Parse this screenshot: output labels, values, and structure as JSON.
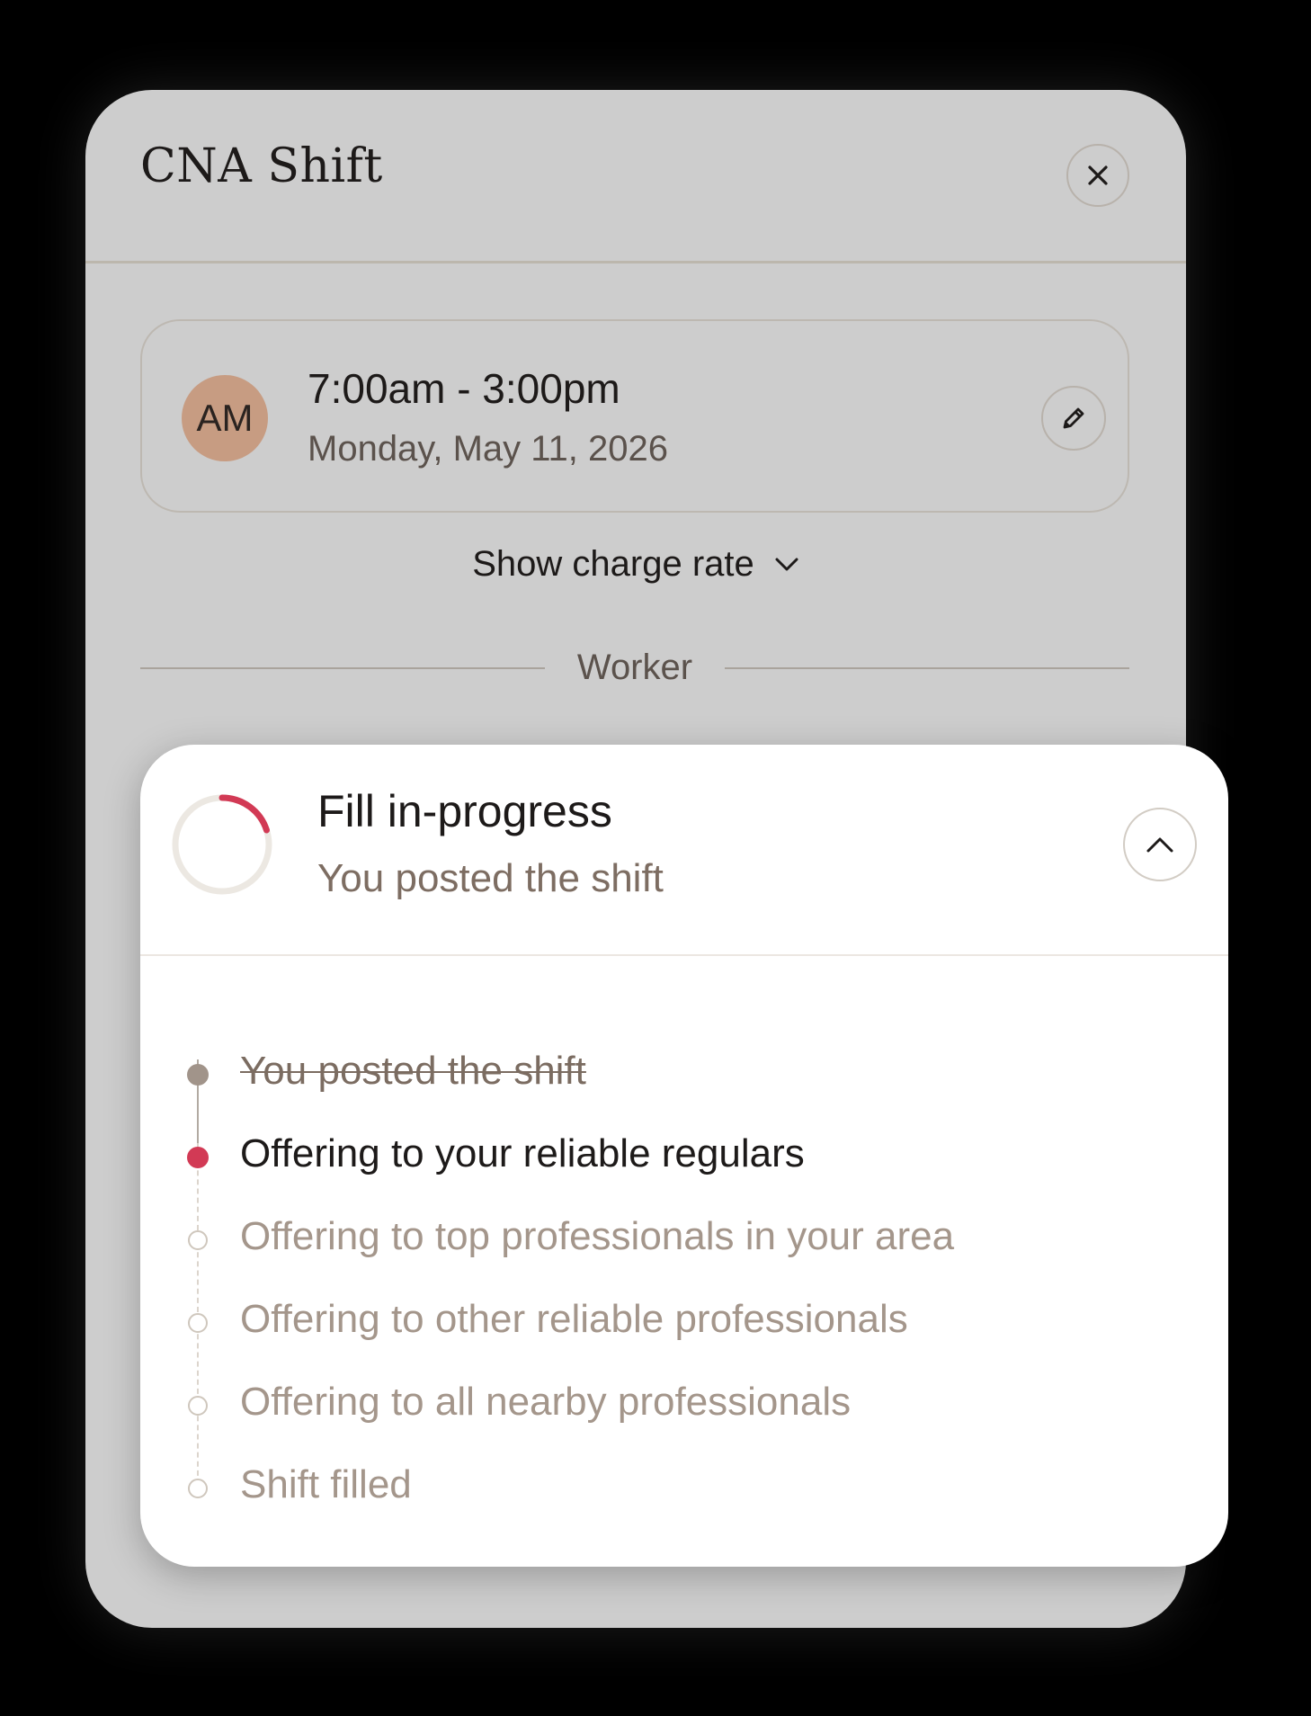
{
  "modal": {
    "title": "CNA Shift"
  },
  "shift": {
    "avatar_initials": "AM",
    "time_range": "7:00am - 3:00pm",
    "date": "Monday, May 11, 2026"
  },
  "charge_rate": {
    "toggle_label": "Show charge rate"
  },
  "worker_section": {
    "label": "Worker"
  },
  "fill_status": {
    "title": "Fill in-progress",
    "subtitle": "You posted the shift",
    "progress_fraction": 0.2,
    "steps": [
      {
        "label": "You posted the shift",
        "state": "done"
      },
      {
        "label": "Offering to your reliable regulars",
        "state": "active"
      },
      {
        "label": "Offering to top professionals in your area",
        "state": "pending"
      },
      {
        "label": "Offering to other reliable professionals",
        "state": "pending"
      },
      {
        "label": "Offering to all nearby professionals",
        "state": "pending"
      },
      {
        "label": "Shift filled",
        "state": "pending"
      }
    ]
  },
  "icons": {
    "close": "close-icon",
    "edit": "pencil-icon",
    "expand": "chevron-down-icon",
    "collapse": "chevron-up-icon"
  },
  "colors": {
    "modal_bg": "#cdcdcd",
    "panel_bg": "#ffffff",
    "accent": "#d23a55",
    "avatar_bg": "#c79c82",
    "done_dot": "#a1948a",
    "pending_text": "#a4968b"
  }
}
